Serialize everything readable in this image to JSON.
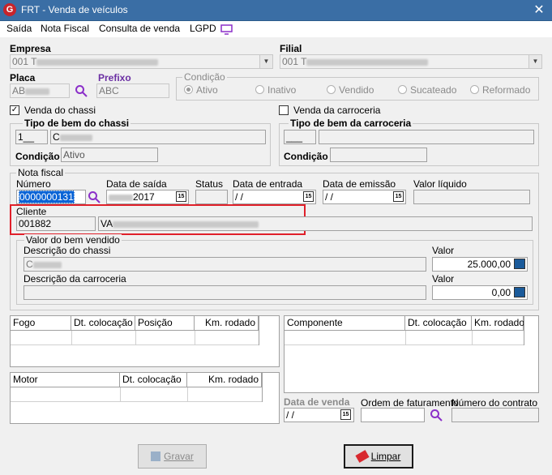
{
  "window": {
    "title": "FRT - Venda de veículos",
    "close": "✕"
  },
  "menu": [
    "Saída",
    "Nota Fiscal",
    "Consulta de venda",
    "LGPD"
  ],
  "empresa": {
    "label": "Empresa",
    "value": "001 T"
  },
  "filial": {
    "label": "Filial",
    "value": "001 T"
  },
  "placa": {
    "label": "Placa",
    "value": "AB"
  },
  "prefixo": {
    "label": "Prefixo",
    "value": "ABC"
  },
  "condicao_group": {
    "label": "Condição",
    "options": [
      "Ativo",
      "Inativo",
      "Vendido",
      "Sucateado",
      "Reformado"
    ],
    "selected": "Ativo"
  },
  "venda_chassi": {
    "label": "Venda do chassi",
    "checked": true
  },
  "venda_carroceria": {
    "label": "Venda da carroceria",
    "checked": false
  },
  "tipo_chassi": {
    "label": "Tipo de bem do chassi",
    "code": "1__",
    "desc": "C",
    "condicao_label": "Condição",
    "condicao_value": "Ativo"
  },
  "tipo_carroceria": {
    "label": "Tipo de bem da carroceria",
    "code": "___",
    "condicao_label": "Condição"
  },
  "nota_fiscal": {
    "label": "Nota fiscal",
    "numero_label": "Número",
    "numero_value": "0000000131",
    "data_saida_label": "Data de saída",
    "data_saida_value": "2017",
    "status_label": "Status",
    "data_entrada_label": "Data de entrada",
    "data_entrada_value": " /  /",
    "data_emissao_label": "Data de emissão",
    "data_emissao_value": " /  /",
    "valor_liquido_label": "Valor líquido",
    "cliente_label": "Cliente",
    "cliente_code": "001882",
    "cliente_name": "VA",
    "cal_icon_text": "15"
  },
  "valor_bem": {
    "label": "Valor do bem vendido",
    "desc_chassi_label": "Descrição do chassi",
    "desc_chassi_value": "C",
    "valor_label": "Valor",
    "valor_chassi": "25.000,00",
    "desc_carroceria_label": "Descrição da carroceria",
    "valor_carroceria": "0,00"
  },
  "grid_fogo": {
    "cols": [
      "Fogo",
      "Dt. colocação",
      "Posição",
      "Km. rodado"
    ]
  },
  "grid_motor": {
    "cols": [
      "Motor",
      "Dt. colocação",
      "Km. rodado"
    ]
  },
  "grid_componente": {
    "cols": [
      "Componente",
      "Dt. colocação",
      "Km. rodado"
    ]
  },
  "data_venda": {
    "label": "Data de venda",
    "value": " /  /"
  },
  "ordem_faturamento": {
    "label": "Ordem de faturamento"
  },
  "numero_contrato": {
    "label": "Número do contrato"
  },
  "buttons": {
    "gravar": "Gravar",
    "limpar": "Limpar"
  },
  "colors": {
    "title_bar": "#3a6ea5",
    "highlight": "#e0202a",
    "accent": "#6b2fa3"
  }
}
